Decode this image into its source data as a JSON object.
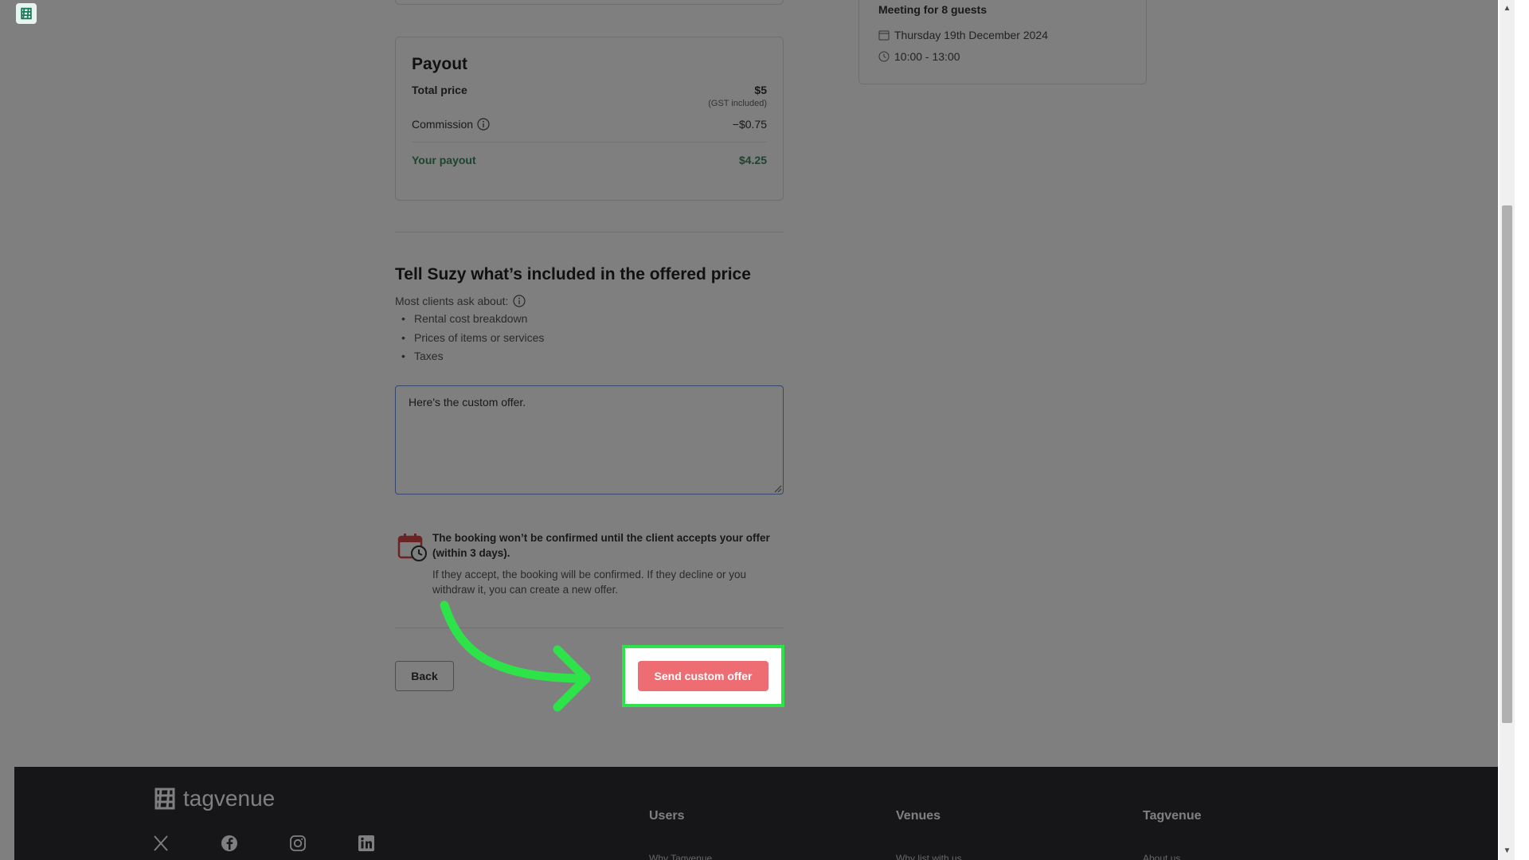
{
  "payout": {
    "title": "Payout",
    "total_label": "Total price",
    "total_value": "$5",
    "gst_note": "(GST included)",
    "commission_label": "Commission",
    "commission_value": "−$0.75",
    "your_payout_label": "Your payout",
    "your_payout_value": "$4.25"
  },
  "included": {
    "heading": "Tell Suzy what’s included in the offered price",
    "ask_label": "Most clients ask about:",
    "bullets": [
      "Rental cost breakdown",
      "Prices of items or services",
      "Taxes"
    ],
    "message_value": "Here's the custom offer."
  },
  "notice": {
    "title": "The booking won’t be confirmed until the client accepts your offer (within 3 days).",
    "body": "If they accept, the booking will be confirmed. If they decline or you withdraw it, you can create a new offer."
  },
  "actions": {
    "back_label": "Back",
    "send_label": "Send custom offer"
  },
  "meeting": {
    "title": "Meeting for 8 guests",
    "date": "Thursday 19th December 2024",
    "time": "10:00 - 13:00"
  },
  "footer": {
    "brand": "tagvenue",
    "columns": [
      {
        "title": "Users",
        "first_link": "Why Tagvenue"
      },
      {
        "title": "Venues",
        "first_link": "Why list with us"
      },
      {
        "title": "Tagvenue",
        "first_link": "About us"
      }
    ],
    "social": [
      "x-icon",
      "facebook-icon",
      "instagram-icon",
      "linkedin-icon"
    ]
  },
  "colors": {
    "accent_button": "#ee6d72",
    "payout_green": "#3a8a5c",
    "highlight": "#2ee24a",
    "footer_bg": "#2d2d31"
  }
}
